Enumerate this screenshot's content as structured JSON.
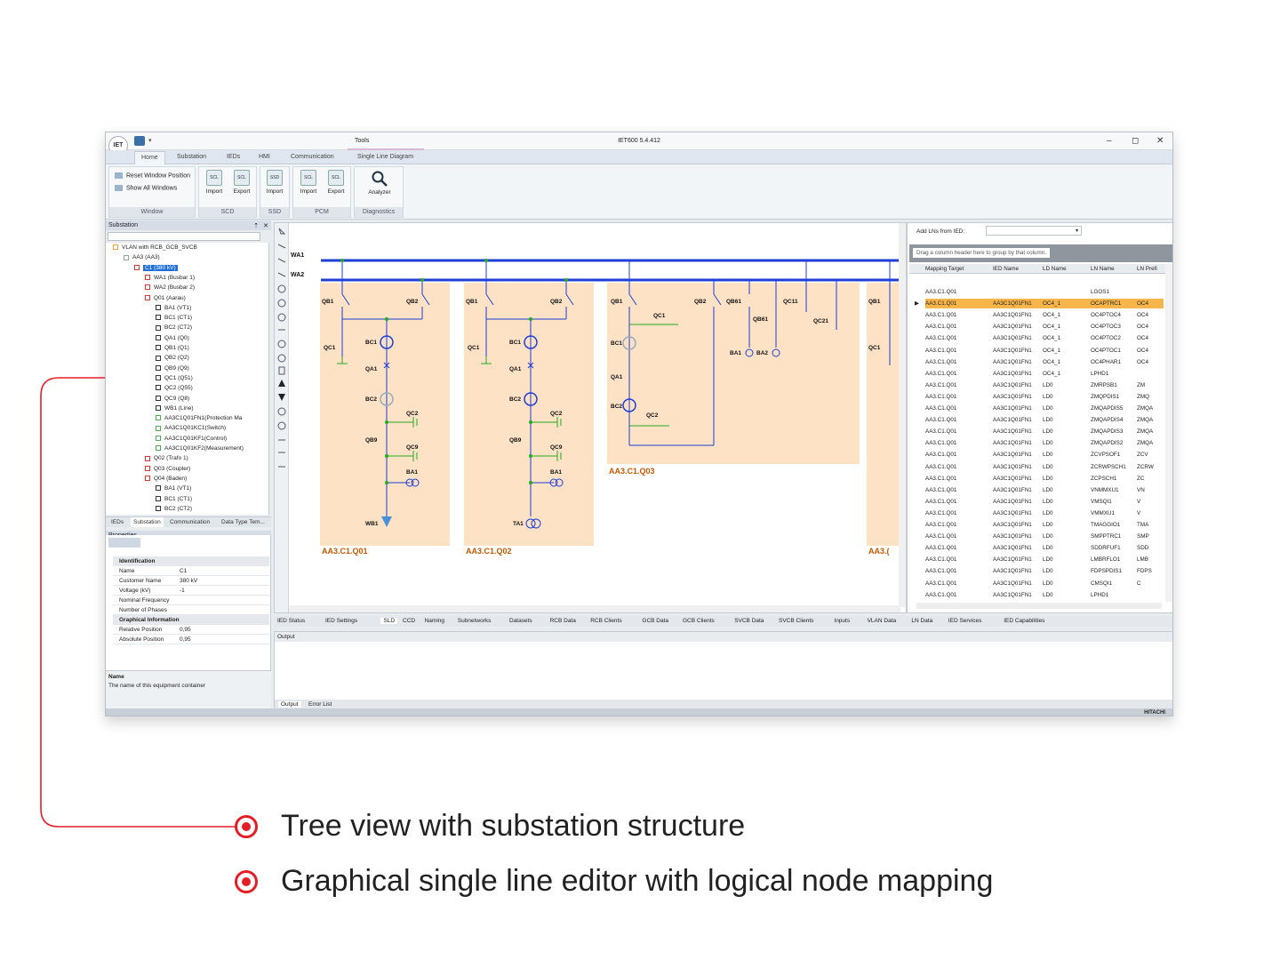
{
  "window": {
    "logo": "IET",
    "tools_tab": "Tools",
    "title": "IET600 5.4.412",
    "controls": [
      "–",
      "◻",
      "✕"
    ]
  },
  "menu": {
    "tabs": [
      "Home",
      "Substation",
      "IEDs",
      "HMI",
      "Communication",
      "Single Line Diagram"
    ]
  },
  "ribbon": {
    "window_group": {
      "label": "Window",
      "items": [
        "Reset Window Position",
        "Show All Windows"
      ]
    },
    "scd_group": {
      "label": "SCD",
      "import": "Import",
      "export": "Export",
      "icon": "SCL"
    },
    "ssd_group": {
      "label": "SSD",
      "import": "Import",
      "icon": "SSD"
    },
    "pcm_group": {
      "label": "PCM",
      "import": "Import",
      "export": "Export",
      "icon": "SCL"
    },
    "diag_group": {
      "label": "Diagnostics",
      "analyzer": "Analyzer"
    }
  },
  "substation_panel": {
    "title": "Substation",
    "pin": "⇡",
    "close": "✕",
    "tree": [
      "VLAN with RCB_GCB_SVCB",
      "AA3 (AA3)",
      "C1 (380 kV)",
      "WA1 (Busbar 1)",
      "WA2 (Busbar 2)",
      "Q01 (Aarau)",
      "BA1 (VT1)",
      "BC1 (CT1)",
      "BC2 (CT2)",
      "QA1 (Q0)",
      "QB1 (Q1)",
      "QB2 (Q2)",
      "QB9 (Q9)",
      "QC1 (Q51)",
      "QC2 (Q55)",
      "QC9 (Q8)",
      "WB1 (Line)",
      "AA3C1Q01FN1(Protection Ma",
      "AA3C1Q01KC1(Switch)",
      "AA3C1Q01KF1(Control)",
      "AA3C1Q01KF2(Measurement)",
      "Q02 (Trafo 1)",
      "Q03 (Coupler)",
      "Q04 (Baden)",
      "BA1 (VT1)",
      "BC1 (CT1)",
      "BC2 (CT2)"
    ],
    "tabs": [
      "IEDs",
      "Substation",
      "Communication",
      "Data Type Tem..."
    ]
  },
  "properties": {
    "title": "Properties",
    "identification": "Identification",
    "rows": [
      {
        "k": "Name",
        "v": "C1"
      },
      {
        "k": "Customer Name",
        "v": "380 kV"
      },
      {
        "k": "Voltage (kV)",
        "v": "-1"
      },
      {
        "k": "Nominal Frequency",
        "v": ""
      },
      {
        "k": "Number of Phases",
        "v": ""
      }
    ],
    "graphical": "Graphical Information",
    "grows": [
      {
        "k": "Relative Position",
        "v": "0,95"
      },
      {
        "k": "Absolute Position",
        "v": "0,95"
      }
    ],
    "desc_title": "Name",
    "desc_text": "The name of this equipment container"
  },
  "sld": {
    "busbars": [
      "WA1",
      "WA2"
    ],
    "bays": [
      "AA3.C1.Q01",
      "AA3.C1.Q02",
      "AA3.C1.Q03",
      "AA3.("
    ],
    "labels": {
      "qb1": "QB1",
      "qb2": "QB2",
      "qc1": "QC1",
      "bc1": "BC1",
      "qa1": "QA1",
      "bc2": "BC2",
      "qc2": "QC2",
      "qb9": "QB9",
      "qc9": "QC9",
      "ba1": "BA1",
      "wb1": "WB1",
      "ta1": "TA1",
      "qb61": "QB61",
      "qc11": "QC11",
      "qc21": "QC21",
      "ba2": "BA2"
    }
  },
  "grid": {
    "add_label": "Add LNs from IED:",
    "group_hint": "Drag a column header here to group by that column.",
    "headers": [
      "Mapping Target",
      "IED Name",
      "LD Name",
      "LN Name",
      "LN Prefi"
    ],
    "rows": [
      [
        "AA3.C1.Q01",
        "",
        "",
        "LGOS1",
        ""
      ],
      [
        "AA3.C1.Q01",
        "AA3C1Q01FN1",
        "OC4_1",
        "OCAPTRC1",
        "OC4"
      ],
      [
        "AA3.C1.Q01",
        "AA3C1Q01FN1",
        "OC4_1",
        "OC4PTOC4",
        "OC4"
      ],
      [
        "AA3.C1.Q01",
        "AA3C1Q01FN1",
        "OC4_1",
        "OC4PTOC3",
        "OC4"
      ],
      [
        "AA3.C1.Q01",
        "AA3C1Q01FN1",
        "OC4_1",
        "OC4PTOC2",
        "OC4"
      ],
      [
        "AA3.C1.Q01",
        "AA3C1Q01FN1",
        "OC4_1",
        "OC4PTOC1",
        "OC4"
      ],
      [
        "AA3.C1.Q01",
        "AA3C1Q01FN1",
        "OC4_1",
        "OC4PHAR1",
        "OC4"
      ],
      [
        "AA3.C1.Q01",
        "AA3C1Q01FN1",
        "OC4_1",
        "LPHD1",
        ""
      ],
      [
        "AA3.C1.Q01",
        "AA3C1Q01FN1",
        "LD0",
        "ZMRPSB1",
        "ZM"
      ],
      [
        "AA3.C1.Q01",
        "AA3C1Q01FN1",
        "LD0",
        "ZMQPDIS1",
        "ZMQ"
      ],
      [
        "AA3.C1.Q01",
        "AA3C1Q01FN1",
        "LD0",
        "ZMQAPDIS5",
        "ZMQA"
      ],
      [
        "AA3.C1.Q01",
        "AA3C1Q01FN1",
        "LD0",
        "ZMQAPDIS4",
        "ZMQA"
      ],
      [
        "AA3.C1.Q01",
        "AA3C1Q01FN1",
        "LD0",
        "ZMQAPDIS3",
        "ZMQA"
      ],
      [
        "AA3.C1.Q01",
        "AA3C1Q01FN1",
        "LD0",
        "ZMQAPDIS2",
        "ZMQA"
      ],
      [
        "AA3.C1.Q01",
        "AA3C1Q01FN1",
        "LD0",
        "ZCVPSOF1",
        "ZCV"
      ],
      [
        "AA3.C1.Q01",
        "AA3C1Q01FN1",
        "LD0",
        "ZCRWPSCH1",
        "ZCRW"
      ],
      [
        "AA3.C1.Q01",
        "AA3C1Q01FN1",
        "LD0",
        "ZCPSCH1",
        "ZC"
      ],
      [
        "AA3.C1.Q01",
        "AA3C1Q01FN1",
        "LD0",
        "VNMMXU1",
        "VN"
      ],
      [
        "AA3.C1.Q01",
        "AA3C1Q01FN1",
        "LD0",
        "VMSQI1",
        "V"
      ],
      [
        "AA3.C1.Q01",
        "AA3C1Q01FN1",
        "LD0",
        "VMMXU1",
        "V"
      ],
      [
        "AA3.C1.Q01",
        "AA3C1Q01FN1",
        "LD0",
        "TMAGGIO1",
        "TMA"
      ],
      [
        "AA3.C1.Q01",
        "AA3C1Q01FN1",
        "LD0",
        "SMPPTRC1",
        "SMP"
      ],
      [
        "AA3.C1.Q01",
        "AA3C1Q01FN1",
        "LD0",
        "SDDRFUF1",
        "SDD"
      ],
      [
        "AA3.C1.Q01",
        "AA3C1Q01FN1",
        "LD0",
        "LMBRFLO1",
        "LMB"
      ],
      [
        "AA3.C1.Q01",
        "AA3C1Q01FN1",
        "LD0",
        "FDPSPDIS1",
        "FDPS"
      ],
      [
        "AA3.C1.Q01",
        "AA3C1Q01FN1",
        "LD0",
        "CMSQI1",
        "C"
      ],
      [
        "AA3.C1.Q01",
        "AA3C1Q01FN1",
        "LD0",
        "LPHD1",
        ""
      ]
    ],
    "selected_row": 1
  },
  "bottom_tabs": [
    "IED Status",
    "IED Settings",
    "SLD",
    "CCD",
    "Naming",
    "Subnetworks",
    "Datasets",
    "RCB Data",
    "RCB Clients",
    "GCB Data",
    "GCB Clients",
    "SVCB Data",
    "SVCB Clients",
    "Inputs",
    "VLAN Data",
    "LN Data",
    "IED Services",
    "IED Capabilities"
  ],
  "output": {
    "title": "Output",
    "tabs": [
      "Output",
      "Error List"
    ]
  },
  "status": {
    "brand": "HITACHI"
  },
  "callouts": [
    "Tree view with substation structure",
    "Graphical single line editor with logical node mapping"
  ],
  "colors": {
    "accent": "#e31e26",
    "busbar": "#1f3fd6",
    "bay": "#fde2c6",
    "selected": "#f7b54a"
  }
}
